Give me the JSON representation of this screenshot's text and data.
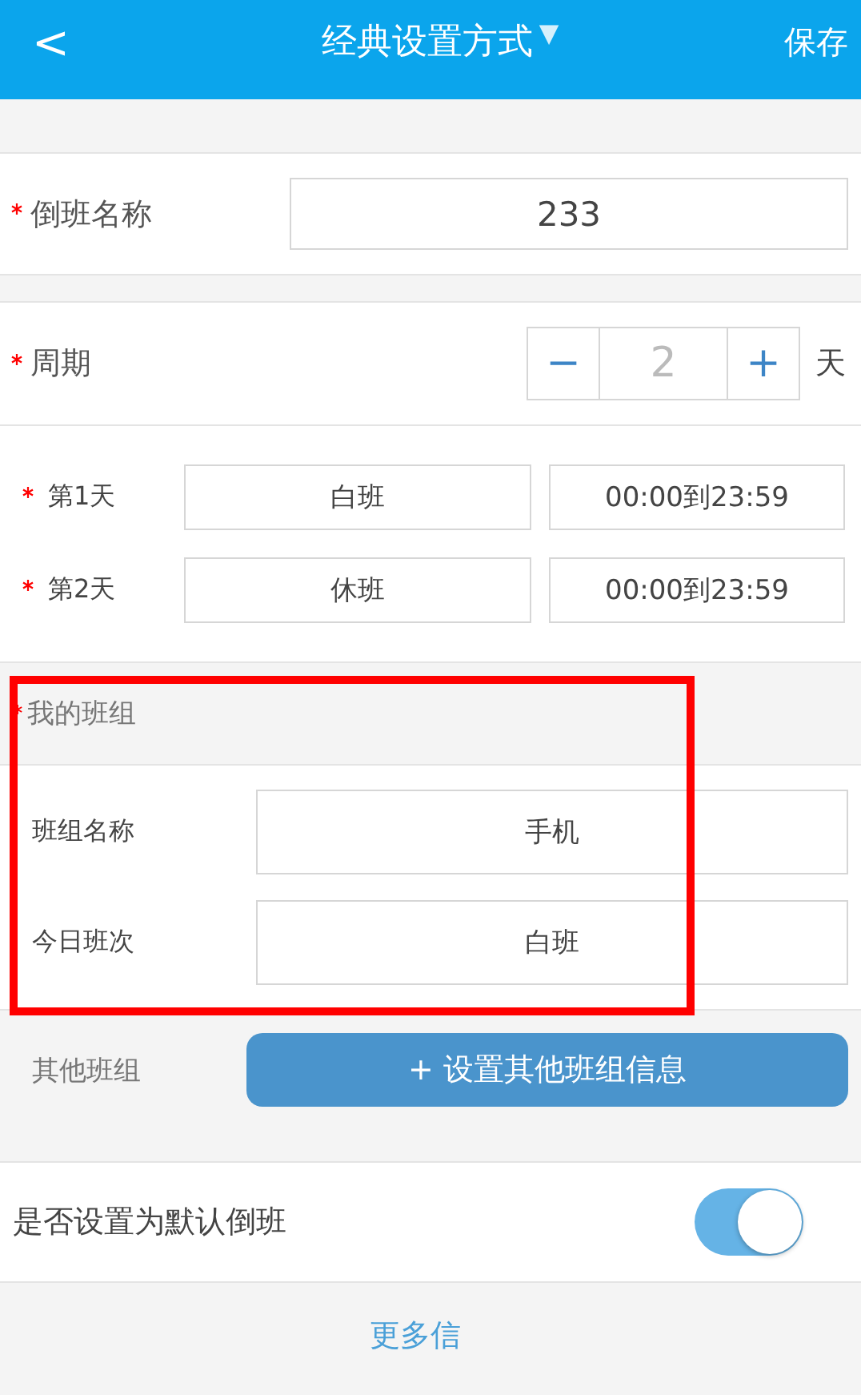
{
  "header": {
    "back": "<",
    "title": "经典设置方式",
    "dropdown": "▼",
    "save": "保存"
  },
  "shift_name": {
    "label": "倒班名称",
    "required": true,
    "value": "233"
  },
  "period": {
    "label": "周期",
    "required": true,
    "minus": "−",
    "value": "2",
    "plus": "+",
    "unit": "天"
  },
  "days": [
    {
      "label": "第1天",
      "required": true,
      "shift": "白班",
      "time": "00:00到23:59"
    },
    {
      "label": "第2天",
      "required": true,
      "shift": "休班",
      "time": "00:00到23:59"
    }
  ],
  "my_team": {
    "title": "我的班组",
    "required": true,
    "highlighted": true,
    "fields": [
      {
        "label": "班组名称",
        "value": "手机"
      },
      {
        "label": "今日班次",
        "value": "白班"
      }
    ]
  },
  "other_team": {
    "label": "其他班组",
    "button": "+ 设置其他班组信息"
  },
  "default_toggle": {
    "label": "是否设置为默认倒班",
    "on": true
  },
  "more_link": "更多信"
}
